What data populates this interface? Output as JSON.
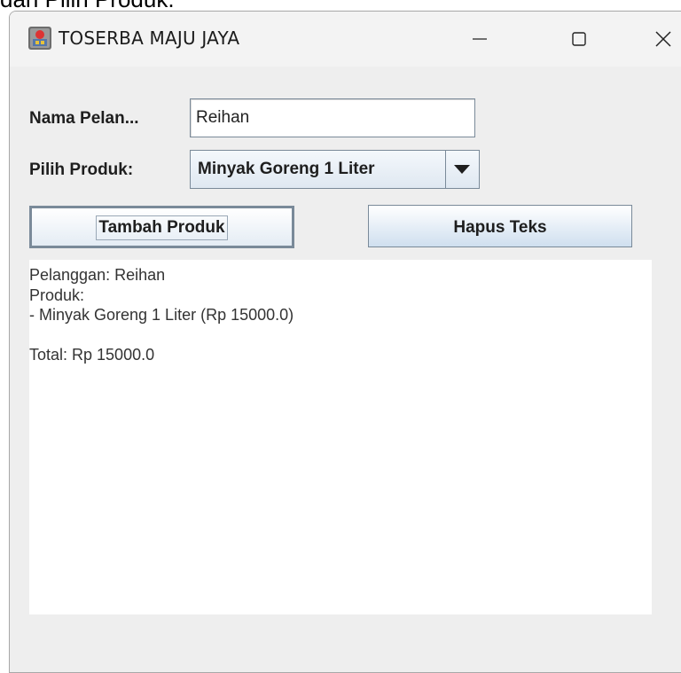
{
  "caption": "dan Pilih Produk.",
  "window": {
    "title": "TOSERBA MAJU JAYA",
    "icon": "java-app-icon",
    "controls": {
      "minimize": "minimize-icon",
      "maximize": "maximize-icon",
      "close": "close-icon"
    }
  },
  "form": {
    "name_label": "Nama Pelan...",
    "name_value": "Reihan",
    "product_label": "Pilih Produk:",
    "product_selected": "Minyak Goreng 1 Liter"
  },
  "buttons": {
    "add": "Tambah Produk",
    "clear": "Hapus Teks"
  },
  "output": {
    "lines": [
      "Pelanggan: Reihan",
      "Produk:",
      "- Minyak Goreng 1 Liter (Rp 15000.0)",
      "",
      "Total: Rp 15000.0"
    ]
  },
  "colors": {
    "window_bg": "#eeeeee",
    "button_gradient_end": "#cfdfef",
    "border": "#7a8a99"
  }
}
